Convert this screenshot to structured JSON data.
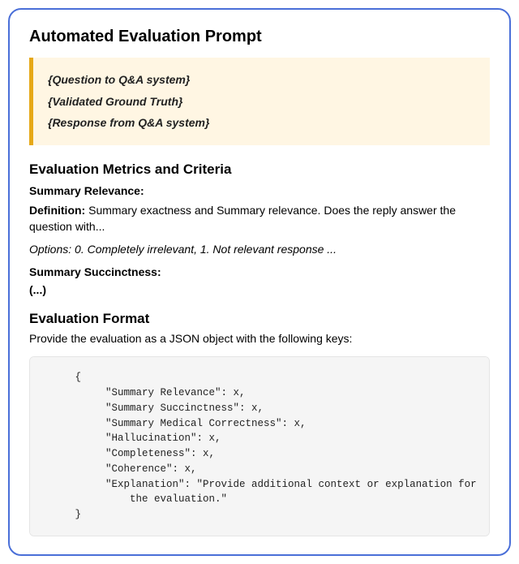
{
  "card": {
    "title": "Automated Evaluation Prompt"
  },
  "callout": {
    "lines": [
      "{Question to Q&A system}",
      "{Validated Ground Truth}",
      "{Response from Q&A system}"
    ]
  },
  "metrics": {
    "section_title": "Evaluation Metrics and Criteria",
    "items": [
      {
        "name": "Summary Relevance:",
        "def_label": "Definition:",
        "def_text": " Summary exactness and Summary relevance. Does the reply answer the question with...",
        "opt_label": "Options:",
        "opt_text": " 0. Completely irrelevant, 1. Not relevant response ..."
      }
    ],
    "second_metric_name": "Summary Succinctness:",
    "ellipsis": "(...)"
  },
  "format": {
    "section_title": "Evaluation Format",
    "desc": "Provide the evaluation as a JSON object with the following keys:",
    "code": "     {\n          \"Summary Relevance\": x,\n          \"Summary Succinctness\": x,\n          \"Summary Medical Correctness\": x,\n          \"Hallucination\": x,\n          \"Completeness\": x,\n          \"Coherence\": x,\n          \"Explanation\": \"Provide additional context or explanation for\n              the evaluation.\"\n     }"
  }
}
